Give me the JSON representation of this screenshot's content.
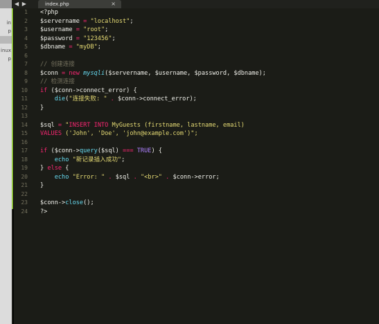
{
  "tab": {
    "nav_arrows": "◀ ▶",
    "filename": "index.php",
    "close": "×"
  },
  "sidebar": {
    "items": [
      "in",
      "p",
      "",
      "inux",
      "p"
    ]
  },
  "line_numbers": [
    "1",
    "2",
    "3",
    "4",
    "5",
    "6",
    "7",
    "8",
    "9",
    "10",
    "11",
    "12",
    "13",
    "14",
    "15",
    "16",
    "17",
    "18",
    "19",
    "20",
    "21",
    "22",
    "23",
    "24"
  ],
  "code": [
    [
      {
        "t": "<?php",
        "c": "pl"
      }
    ],
    [
      {
        "t": "$servername",
        "c": "var"
      },
      {
        "t": " = ",
        "c": "kw"
      },
      {
        "t": "\"localhost\"",
        "c": "str"
      },
      {
        "t": ";",
        "c": "pl"
      }
    ],
    [
      {
        "t": "$username",
        "c": "var"
      },
      {
        "t": " = ",
        "c": "kw"
      },
      {
        "t": "\"root\"",
        "c": "str"
      },
      {
        "t": ";",
        "c": "pl"
      }
    ],
    [
      {
        "t": "$password",
        "c": "var"
      },
      {
        "t": " = ",
        "c": "kw"
      },
      {
        "t": "\"123456\"",
        "c": "str"
      },
      {
        "t": ";",
        "c": "pl"
      }
    ],
    [
      {
        "t": "$dbname",
        "c": "var"
      },
      {
        "t": " = ",
        "c": "kw"
      },
      {
        "t": "\"myDB\"",
        "c": "str"
      },
      {
        "t": ";",
        "c": "pl"
      }
    ],
    [],
    [
      {
        "t": "// 创建连接",
        "c": "cm"
      }
    ],
    [
      {
        "t": "$conn",
        "c": "var"
      },
      {
        "t": " = ",
        "c": "kw"
      },
      {
        "t": "new ",
        "c": "kw"
      },
      {
        "t": "mysqli",
        "c": "it"
      },
      {
        "t": "($servername, $username, $password, $dbname);",
        "c": "pl"
      }
    ],
    [
      {
        "t": "// 检测连接",
        "c": "cm"
      }
    ],
    [
      {
        "t": "if",
        "c": "kw"
      },
      {
        "t": " ($conn->connect_error) {",
        "c": "pl"
      }
    ],
    [
      {
        "t": "    ",
        "c": "pl"
      },
      {
        "t": "die",
        "c": "fn"
      },
      {
        "t": "(",
        "c": "pl"
      },
      {
        "t": "\"连接失败: \"",
        "c": "str"
      },
      {
        "t": " . ",
        "c": "kw"
      },
      {
        "t": "$conn->connect_error);",
        "c": "pl"
      }
    ],
    [
      {
        "t": "}",
        "c": "pl"
      }
    ],
    [],
    [
      {
        "t": "$sql",
        "c": "var"
      },
      {
        "t": " = ",
        "c": "kw"
      },
      {
        "t": "\"",
        "c": "str"
      },
      {
        "t": "INSERT INTO",
        "c": "kw"
      },
      {
        "t": " MyGuests (firstname, lastname, email)",
        "c": "str"
      }
    ],
    [
      {
        "t": "VALUES",
        "c": "kw"
      },
      {
        "t": " ('John', 'Doe', 'john@example.com')\";",
        "c": "str"
      }
    ],
    [],
    [
      {
        "t": "if",
        "c": "kw"
      },
      {
        "t": " ($conn->",
        "c": "pl"
      },
      {
        "t": "query",
        "c": "fn"
      },
      {
        "t": "($sql) ",
        "c": "pl"
      },
      {
        "t": "===",
        "c": "kw"
      },
      {
        "t": " ",
        "c": "pl"
      },
      {
        "t": "TRUE",
        "c": "cons"
      },
      {
        "t": ") {",
        "c": "pl"
      }
    ],
    [
      {
        "t": "    ",
        "c": "pl"
      },
      {
        "t": "echo",
        "c": "fn"
      },
      {
        "t": " ",
        "c": "pl"
      },
      {
        "t": "\"新记录插入成功\"",
        "c": "str"
      },
      {
        "t": ";",
        "c": "pl"
      }
    ],
    [
      {
        "t": "} ",
        "c": "pl"
      },
      {
        "t": "else",
        "c": "kw"
      },
      {
        "t": " {",
        "c": "pl"
      }
    ],
    [
      {
        "t": "    ",
        "c": "pl"
      },
      {
        "t": "echo",
        "c": "fn"
      },
      {
        "t": " ",
        "c": "pl"
      },
      {
        "t": "\"Error: \"",
        "c": "str"
      },
      {
        "t": " . ",
        "c": "kw"
      },
      {
        "t": "$sql",
        "c": "var"
      },
      {
        "t": " . ",
        "c": "kw"
      },
      {
        "t": "\"<br>\"",
        "c": "str"
      },
      {
        "t": " . ",
        "c": "kw"
      },
      {
        "t": "$conn->error;",
        "c": "pl"
      }
    ],
    [
      {
        "t": "}",
        "c": "pl"
      }
    ],
    [],
    [
      {
        "t": "$conn->",
        "c": "var"
      },
      {
        "t": "close",
        "c": "fn"
      },
      {
        "t": "();",
        "c": "pl"
      }
    ],
    [
      {
        "t": "?>",
        "c": "pl"
      }
    ]
  ],
  "colors": {
    "background": "#1b1c17",
    "keyword": "#f92672",
    "string": "#e6db74",
    "function": "#66d9ef",
    "comment": "#75715e",
    "constant": "#ae81ff"
  }
}
